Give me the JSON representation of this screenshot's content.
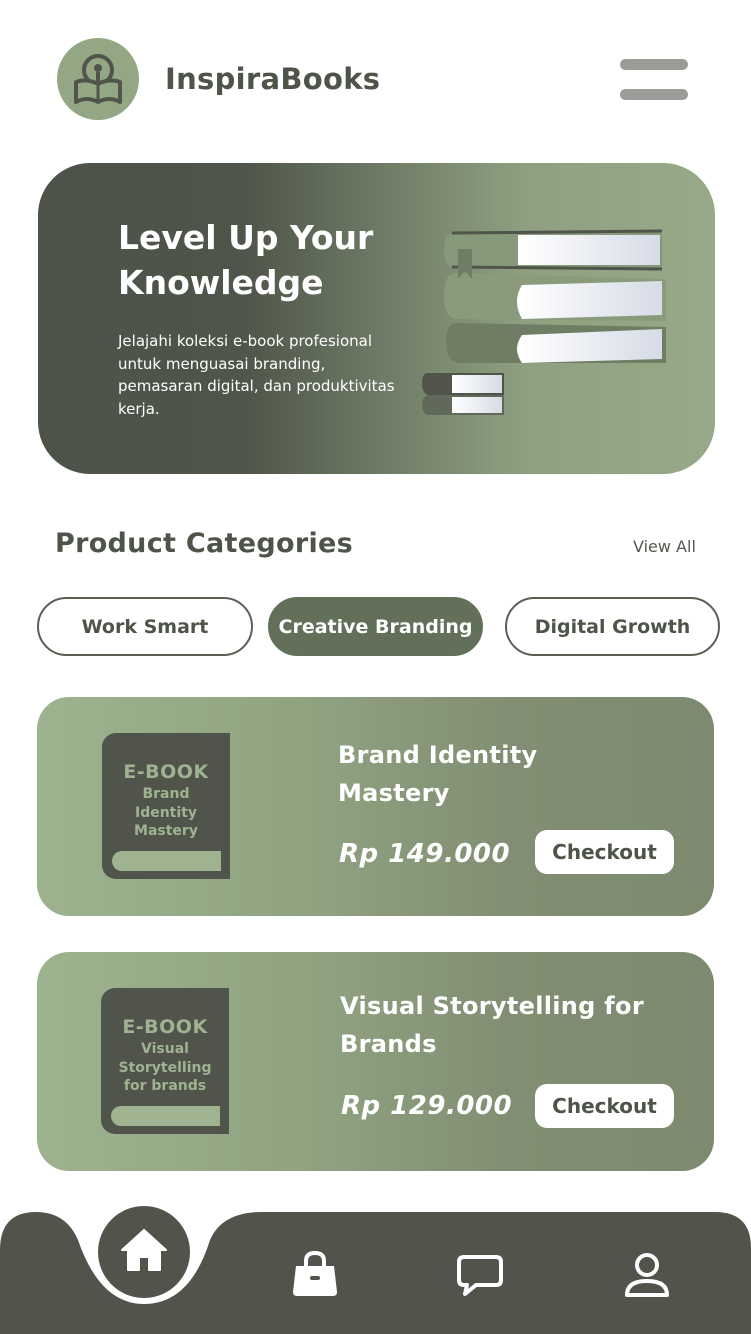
{
  "header": {
    "brand": "InspiraBooks",
    "logo_icon": "book-bulb-icon",
    "menu_icon": "hamburger-menu-icon"
  },
  "hero": {
    "title_line1": "Level Up Your",
    "title_line2": "Knowledge",
    "description": "Jelajahi koleksi e-book profesional untuk menguasai branding, pemasaran digital, dan produktivitas kerja.",
    "illustration": "stacked-books-icon"
  },
  "categories": {
    "title": "Product Categories",
    "view_all": "View All",
    "chips": [
      {
        "label": "Work Smart",
        "active": false
      },
      {
        "label": "Creative Branding",
        "active": true
      },
      {
        "label": "Digital Growth",
        "active": false
      }
    ]
  },
  "products": [
    {
      "cover_label": "E-BOOK",
      "cover_line1": "Brand",
      "cover_line2": "Identity",
      "cover_line3": "Mastery",
      "title_line1": "Brand Identity",
      "title_line2": "Mastery",
      "price": "Rp 149.000",
      "button": "Checkout"
    },
    {
      "cover_label": "E-BOOK",
      "cover_line1": "Visual",
      "cover_line2": "Storytelling",
      "cover_line3": "for brands",
      "title_line1": "Visual Storytelling for",
      "title_line2": "Brands",
      "price": "Rp 129.000",
      "button": "Checkout"
    }
  ],
  "bottom_nav": {
    "items": [
      "home-icon",
      "shopping-bag-icon",
      "chat-icon",
      "user-icon"
    ],
    "active": "home-icon"
  },
  "colors": {
    "primary_dark": "#50544b",
    "sage": "#93a784",
    "chip_active": "#62705a",
    "text": "#4f5449"
  }
}
